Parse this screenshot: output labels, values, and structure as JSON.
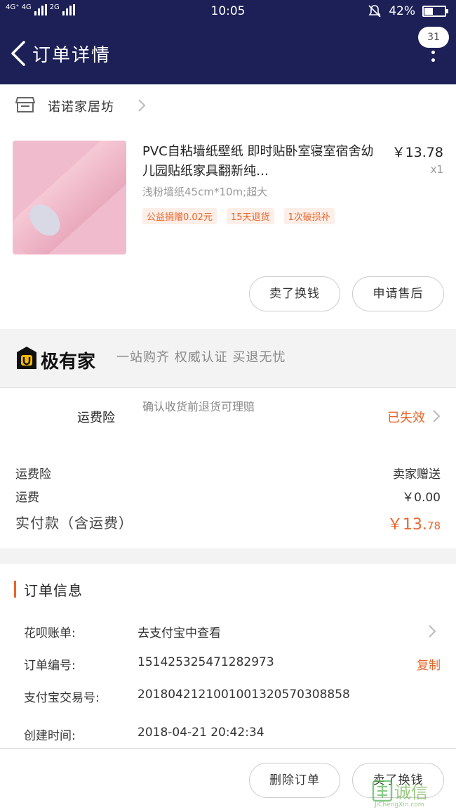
{
  "status_bar": {
    "network_left": "4G⁺ 4G",
    "network_right": "2G",
    "time": "10:05",
    "battery": "42%",
    "battery_level": 0.42
  },
  "nav": {
    "title": "订单详情",
    "badge": "31"
  },
  "store": {
    "name": "诺诺家居坊"
  },
  "product": {
    "title": "PVC自粘墙纸壁纸 即时贴卧室寝室宿舍幼儿园贴纸家具翻新纯…",
    "price": "￥13.78",
    "qty": "x1",
    "spec": "浅粉墙纸45cm*10m;超大",
    "tags": [
      "公益捐赠0.02元",
      "15天退货",
      "1次破损补"
    ],
    "btn_sell": "卖了换钱",
    "btn_aftersale": "申请售后"
  },
  "promo": {
    "brand": "极有家",
    "slogan": "一站购齐 权威认证 买退无忧"
  },
  "insurance": {
    "label": "运费险",
    "desc": "确认收货前退货可理赔",
    "status": "已失效"
  },
  "summary": {
    "ins_label": "运费险",
    "ins_value": "卖家赠送",
    "ship_label": "运费",
    "ship_value": "￥0.00",
    "paid_label": "实付款（含运费）",
    "paid_main": "￥13.",
    "paid_cents": "78"
  },
  "order_info": {
    "heading": "订单信息",
    "rows": [
      {
        "key": "花呗账单:",
        "value": "去支付宝中查看"
      },
      {
        "key": "订单编号:",
        "value": "151425325471282973",
        "action": "复制"
      },
      {
        "key": "支付宝交易号:",
        "value": "2018042121001001320570308858"
      },
      {
        "key": "创建时间:",
        "value": "2018-04-21 20:42:34"
      }
    ]
  },
  "bottom": {
    "btn_delete": "删除订单",
    "btn_sell": "卖了换钱"
  },
  "watermark": {
    "brand": "诚信",
    "site": "JiChengXin.com"
  }
}
